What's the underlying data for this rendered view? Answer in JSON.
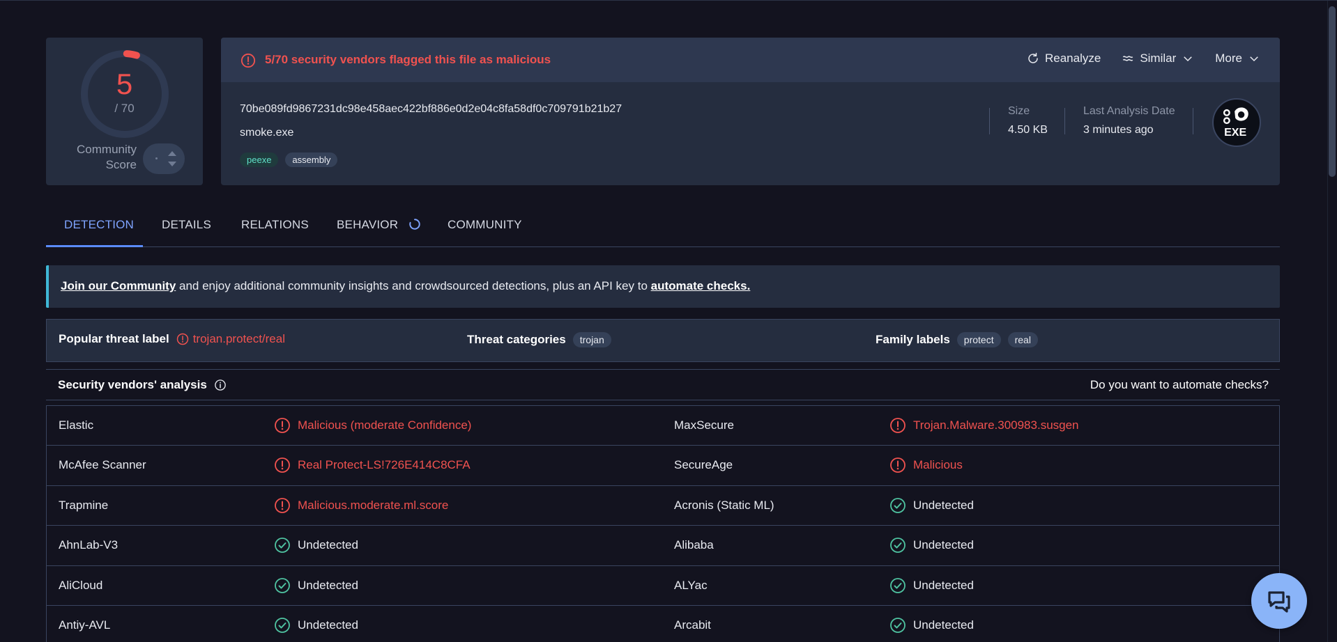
{
  "score": {
    "detections": "5",
    "total": "/ 70",
    "community_label_line1": "Community",
    "community_label_line2": "Score",
    "detection_fraction": 0.0714
  },
  "summary": {
    "alert": "5/70 security vendors flagged this file as malicious",
    "actions": {
      "reanalyze": "Reanalyze",
      "similar": "Similar",
      "more": "More"
    },
    "hash": "70be089fd9867231dc98e458aec422bf886e0d2e04c8fa58df0c709791b21b27",
    "filename": "smoke.exe",
    "tags": [
      "peexe",
      "assembly"
    ],
    "size_label": "Size",
    "size_value": "4.50 KB",
    "date_label": "Last Analysis Date",
    "date_value": "3 minutes ago",
    "file_type": "EXE"
  },
  "tabs": [
    "DETECTION",
    "DETAILS",
    "RELATIONS",
    "BEHAVIOR",
    "COMMUNITY"
  ],
  "banner": {
    "link1": "Join our Community",
    "middle": " and enjoy additional community insights and crowdsourced detections, plus an API key to ",
    "link2": "automate checks."
  },
  "threat": {
    "popular_label": "Popular threat label",
    "popular_value": "trojan.protect/real",
    "categories_label": "Threat categories",
    "categories": [
      "trojan"
    ],
    "family_label": "Family labels",
    "families": [
      "protect",
      "real"
    ]
  },
  "vendors_head": {
    "title": "Security vendors' analysis",
    "automate": "Do you want to automate checks?"
  },
  "vendors": [
    [
      {
        "name": "Elastic",
        "result": "Malicious (moderate Confidence)",
        "status": "malicious"
      },
      {
        "name": "MaxSecure",
        "result": "Trojan.Malware.300983.susgen",
        "status": "malicious"
      }
    ],
    [
      {
        "name": "McAfee Scanner",
        "result": "Real Protect-LS!726E414C8CFA",
        "status": "malicious"
      },
      {
        "name": "SecureAge",
        "result": "Malicious",
        "status": "malicious"
      }
    ],
    [
      {
        "name": "Trapmine",
        "result": "Malicious.moderate.ml.score",
        "status": "malicious"
      },
      {
        "name": "Acronis (Static ML)",
        "result": "Undetected",
        "status": "undetected"
      }
    ],
    [
      {
        "name": "AhnLab-V3",
        "result": "Undetected",
        "status": "undetected"
      },
      {
        "name": "Alibaba",
        "result": "Undetected",
        "status": "undetected"
      }
    ],
    [
      {
        "name": "AliCloud",
        "result": "Undetected",
        "status": "undetected"
      },
      {
        "name": "ALYac",
        "result": "Undetected",
        "status": "undetected"
      }
    ],
    [
      {
        "name": "Antiy-AVL",
        "result": "Undetected",
        "status": "undetected"
      },
      {
        "name": "Arcabit",
        "result": "Undetected",
        "status": "undetected"
      }
    ]
  ],
  "colors": {
    "malicious": "#f0524f",
    "undetected": "#4fc3a1",
    "accent": "#5b8cff"
  }
}
